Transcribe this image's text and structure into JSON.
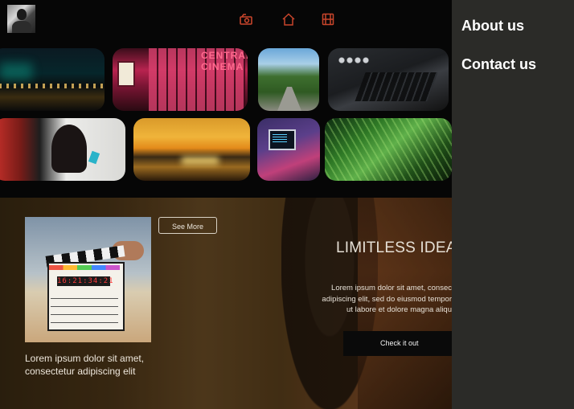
{
  "nav": {
    "icons": [
      "camera-icon",
      "home-icon",
      "film-icon"
    ],
    "accent": "#c8452b"
  },
  "gallery": {
    "row1": [
      "night-harbor-photo",
      "central-cinema-photo",
      "forest-road-photo",
      "editing-desk-photo"
    ],
    "row2": [
      "camera-crew-photo",
      "sunset-beach-photo",
      "laptop-code-photo",
      "palm-leaves-photo"
    ],
    "cinema_sign": "CENTRAL CINEMA"
  },
  "hero": {
    "see_more": "See More",
    "caption": "Lorem ipsum dolor sit amet, consectetur adipiscing elit",
    "title": "LIMITLESS IDEA",
    "description_lines": [
      "Lorem ipsum dolor sit amet, consec",
      "adipiscing elit, sed do eiusmod tempor",
      "ut labore et dolore magna aliqu"
    ],
    "cta": "Check it out",
    "clapper_time": "16:21:34:21"
  },
  "side_menu": {
    "about": "About us",
    "contact": "Contact us",
    "background": "#2b2b28"
  }
}
